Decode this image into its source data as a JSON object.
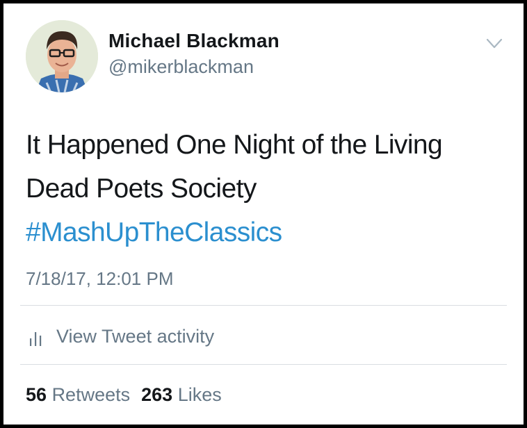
{
  "tweet": {
    "author_name": "Michael Blackman",
    "author_handle": "@mikerblackman",
    "text_lines": [
      "It Happened One Night of the Living",
      "Dead Poets Society"
    ],
    "hashtag": "#MashUpTheClassics",
    "timestamp": "7/18/17, 12:01 PM"
  },
  "activity": {
    "label": "View Tweet activity",
    "icon": "bar-chart-icon"
  },
  "stats": {
    "retweets_count": "56",
    "retweets_label": "Retweets",
    "likes_count": "263",
    "likes_label": "Likes"
  },
  "colors": {
    "text": "#14171a",
    "secondary": "#657786",
    "hashtag": "#2b8fcf",
    "divider": "#d9dde1",
    "frame": "#000000"
  },
  "icons": {
    "menu": "chevron-down-icon",
    "avatar": "profile-photo"
  }
}
